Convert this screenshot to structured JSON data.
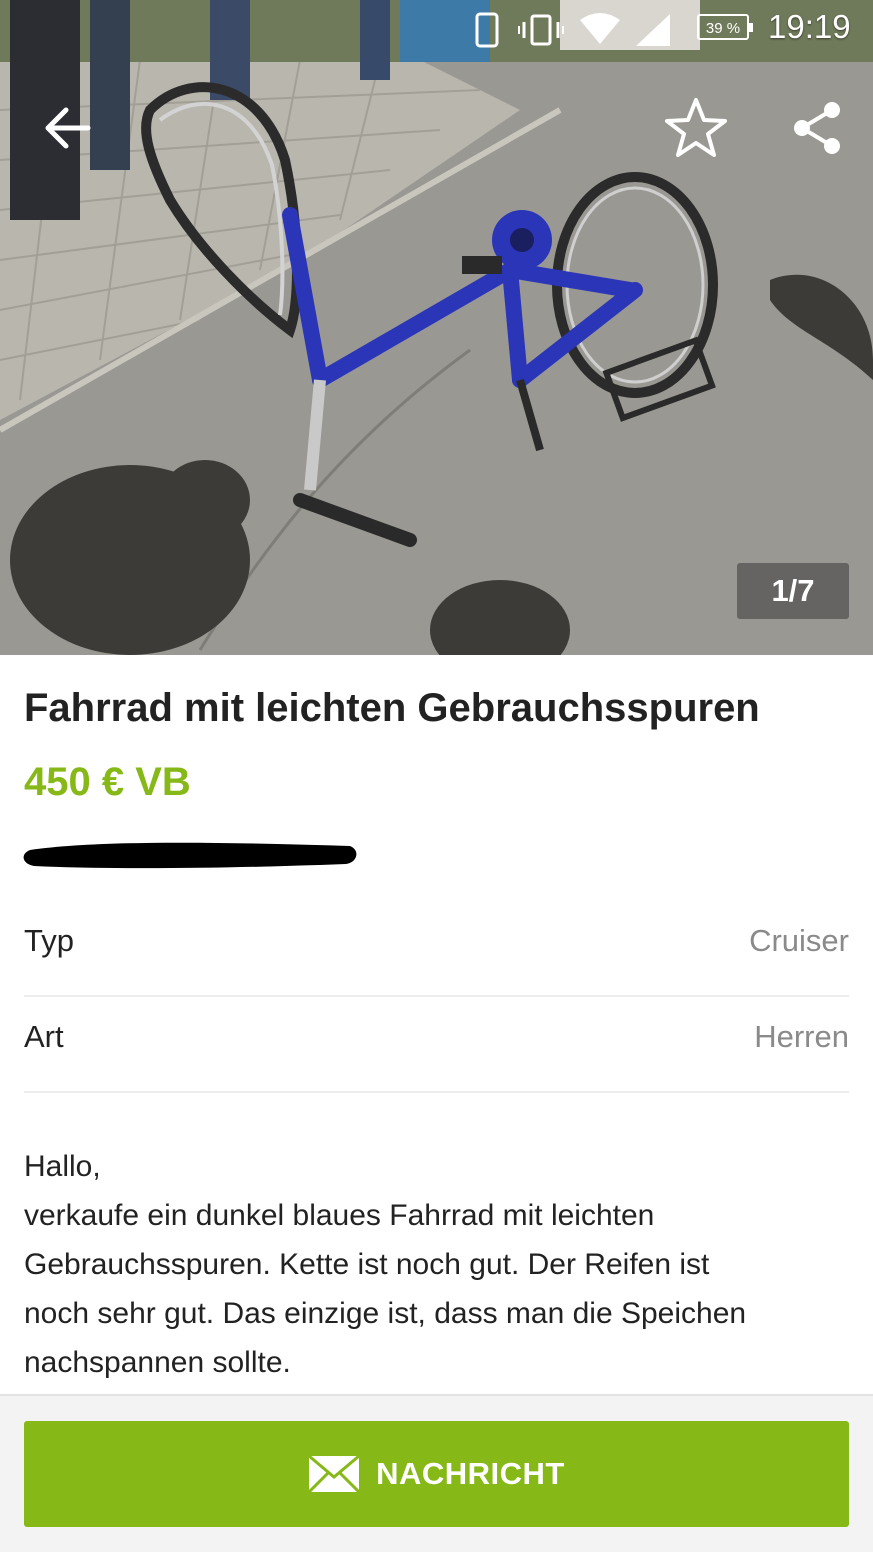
{
  "status_bar": {
    "battery": "39 %",
    "time": "19:19"
  },
  "gallery": {
    "counter": "1/7",
    "description": "Photo of a dark blue bicycle with a bent front wheel lying on asphalt"
  },
  "toolbar": {
    "back_icon": "arrow-left-icon",
    "favorite_icon": "star-outline-icon",
    "share_icon": "share-icon"
  },
  "listing": {
    "title": "Fahrrad mit leichten Gebrauchsspuren",
    "price": "450 € VB"
  },
  "attributes": [
    {
      "label": "Typ",
      "value": "Cruiser"
    },
    {
      "label": "Art",
      "value": "Herren"
    }
  ],
  "description": {
    "lines": [
      "Hallo,",
      "verkaufe ein dunkel blaues Fahrrad mit leichten",
      "Gebrauchsspuren. Kette ist noch gut. Der Reifen ist",
      "noch sehr gut. Das einzige ist, dass man die Speichen",
      "nachspannen sollte."
    ]
  },
  "action": {
    "message_label": "NACHRICHT",
    "message_icon": "envelope-icon"
  },
  "colors": {
    "accent": "#86b817",
    "text": "#222222",
    "muted": "#8a8a8a"
  }
}
